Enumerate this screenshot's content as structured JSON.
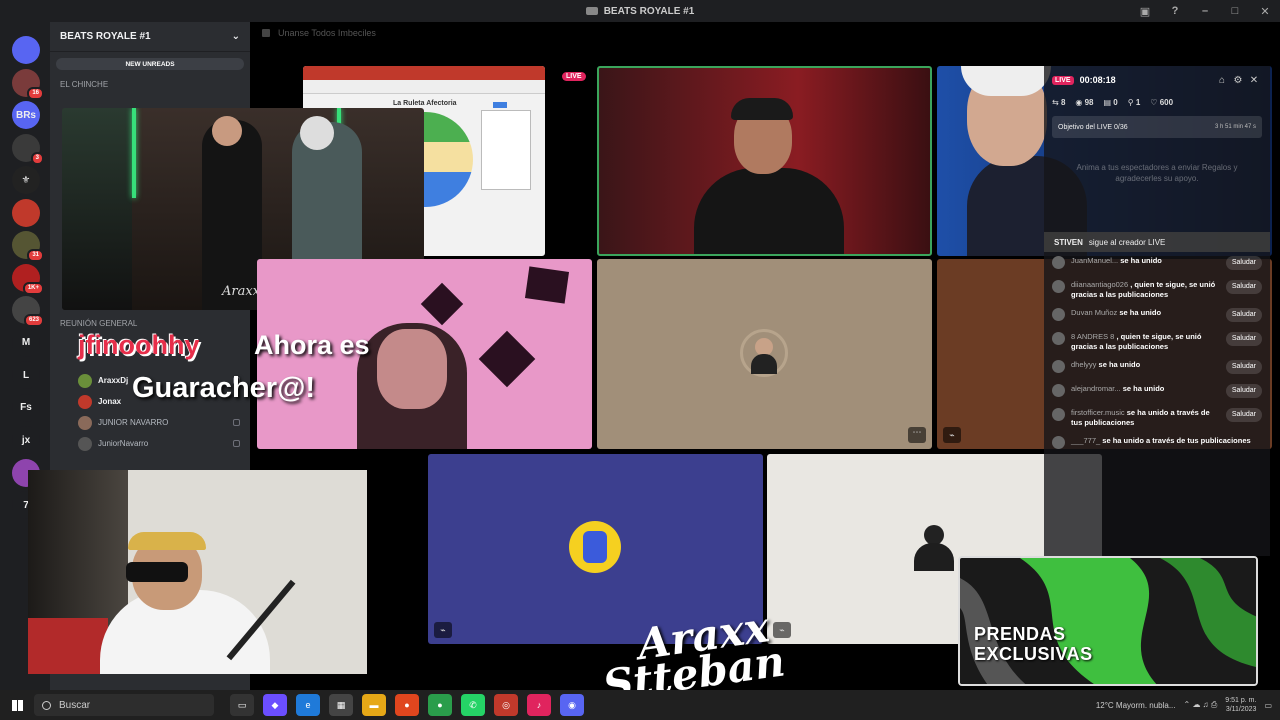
{
  "window": {
    "title": "BEATS ROYALE #1"
  },
  "server": {
    "name": "BEATS ROYALE #1",
    "new_unreads": "NEW UNREADS",
    "category_top": "EL CHINCHE",
    "category_voice": "REUNIÓN GENERAL",
    "voice_members": [
      "AraxxDj",
      "Jonax",
      "JUNIOR NAVARRO",
      "JuniorNavarro"
    ]
  },
  "rail": {
    "servers": [
      {
        "label": "",
        "color": "#5865f2",
        "badge": ""
      },
      {
        "label": "",
        "color": "#7a3b3b",
        "badge": "16"
      },
      {
        "label": "BRs",
        "color": "#5865f2",
        "badge": ""
      },
      {
        "label": "",
        "color": "#3a3a3a",
        "badge": "3"
      },
      {
        "label": "⚜",
        "color": "#222",
        "badge": ""
      },
      {
        "label": "",
        "color": "#c0392b",
        "badge": ""
      },
      {
        "label": "",
        "color": "#553",
        "badge": "31"
      },
      {
        "label": "",
        "color": "#b02020",
        "badge": "1K+"
      },
      {
        "label": "",
        "color": "#444",
        "badge": "623"
      },
      {
        "label": "M",
        "color": "#1e1f22",
        "badge": ""
      },
      {
        "label": "L",
        "color": "#1e1f22",
        "badge": ""
      },
      {
        "label": "Fs",
        "color": "#1e1f22",
        "badge": ""
      },
      {
        "label": "jx",
        "color": "#1e1f22",
        "badge": ""
      },
      {
        "label": "",
        "color": "#8e44ad",
        "badge": ""
      },
      {
        "label": "7",
        "color": "#1e1f22",
        "badge": ""
      }
    ]
  },
  "main": {
    "channel_header": "Unanse Todos Imbeciles"
  },
  "live_panel": {
    "live_label": "LIVE",
    "time": "00:08:18",
    "stats": [
      "8",
      "98",
      "0",
      "1",
      "600"
    ],
    "goal_label": "Objetivo del LIVE 0/36",
    "goal_value": "3 h 51 min 47 s",
    "hint": "Anima a tus espectadores a enviar Regalos y agradecerles su apoyo.",
    "creator_user": "STIVEN",
    "creator_text": "sigue al creador LIVE",
    "feed": [
      {
        "user": "JuanManuel...",
        "text": "se ha unido",
        "action": "Saludar"
      },
      {
        "user": "diianaantiago026",
        "text": ", quien te sigue, se unió gracias a las publicaciones",
        "action": "Saludar"
      },
      {
        "user": "Duvan Muñoz",
        "text": "se ha unido",
        "action": "Saludar"
      },
      {
        "user": "8 ANDRES 8",
        "text": ", quien te sigue, se unió gracias a las publicaciones",
        "action": "Saludar"
      },
      {
        "user": "dhelyyy",
        "text": "se ha unido",
        "action": "Saludar"
      },
      {
        "user": "alejandromar...",
        "text": "se ha unido",
        "action": "Saludar"
      },
      {
        "user": "firstofficer.music",
        "text": "se ha unido a través de tus publicaciones",
        "action": "Saludar"
      },
      {
        "user": "___777_",
        "text": "se ha unido a través de tus publicaciones",
        "action": ""
      }
    ]
  },
  "overlay": {
    "live_tag": "LIVE",
    "alert_name": "jfinoohhy",
    "alert_line1": "Ahora es",
    "alert_line2": "Guaracher@!",
    "watermark_line1": "Araxx",
    "watermark_line2": "Stteban",
    "promo": [
      "PRENDAS",
      "EXCLUSIVAS"
    ],
    "wheel_title": "La Ruleta Afectoria"
  },
  "taskbar": {
    "search": "Buscar",
    "weather": "12°C  Mayorm. nubla...",
    "time": "9:51 p. m.",
    "date": "3/11/2023"
  }
}
